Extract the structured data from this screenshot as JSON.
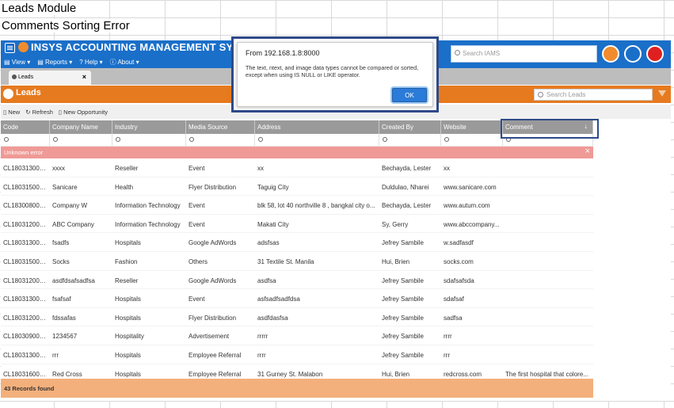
{
  "captions": {
    "line1": "Leads Module",
    "line2": "Comments Sorting Error"
  },
  "app": {
    "title": "INSYS ACCOUNTING MANAGEMENT SYSTEM",
    "menu": [
      "View",
      "Reports",
      "Help",
      "About"
    ],
    "search_placeholder": "Search IAMS",
    "colors": {
      "header": "#1a6fc9",
      "accent": "#e67a1f",
      "error": "#ef9a96",
      "footer": "#f3b07c"
    }
  },
  "tab": {
    "label": "Leads"
  },
  "leads": {
    "title": "Leads",
    "search_placeholder": "Search Leads",
    "toolbar": {
      "new": "New",
      "refresh": "Refresh",
      "new_opportunity": "New Opportunity"
    }
  },
  "grid": {
    "columns": [
      "Code",
      "Company Name",
      "Industry",
      "Media Source",
      "Address",
      "Created By",
      "Website",
      "Comment"
    ],
    "sort_indicator": "↓",
    "error_text": "Unknown error",
    "rows": [
      [
        "CL180313000...",
        "xxxx",
        "Reseller",
        "Event",
        "xx",
        "Bechayda, Lester",
        "xx",
        ""
      ],
      [
        "CL180315000...",
        "Sanicare",
        "Health",
        "Flyer Distribution",
        "Taguig City",
        "Duldulao, Nharei",
        "www.sanicare.com",
        ""
      ],
      [
        "CL183008000...",
        "Company W",
        "Information Technology",
        "Event",
        "blk 58, lot 40 northville 8 , bangkal city o...",
        "Bechayda, Lester",
        "www.autum.com",
        ""
      ],
      [
        "CL180312000...",
        "ABC Company",
        "Information Technology",
        "Event",
        "Makati City",
        "Sy, Gerry",
        "www.abccompany...",
        ""
      ],
      [
        "CL180313000...",
        "fsadfs",
        "Hospitals",
        "Google AdWords",
        "adsfsas",
        "Jefrey Sambile",
        "w.sadfasdf",
        ""
      ],
      [
        "CL180315000...",
        "Socks",
        "Fashion",
        "Others",
        "31 Textile St. Manila",
        "Hui, Brien",
        "socks.com",
        ""
      ],
      [
        "CL180312000...",
        "asdfdsafsadfsa",
        "Reseller",
        "Google AdWords",
        "asdfsa",
        "Jefrey Sambile",
        "sdafsafsda",
        ""
      ],
      [
        "CL180313000...",
        "fsafsaf",
        "Hospitals",
        "Event",
        "asfsadfsadfdsa",
        "Jefrey Sambile",
        "sdafsaf",
        ""
      ],
      [
        "CL180312000...",
        "fdssafas",
        "Hospitals",
        "Flyer Distribution",
        "asdfdasfsa",
        "Jefrey Sambile",
        "sadfsa",
        ""
      ],
      [
        "CL180309000...",
        "1234567",
        "Hospitality",
        "Advertisement",
        "rrrrr",
        "Jefrey Sambile",
        "rrrr",
        ""
      ],
      [
        "CL180313000...",
        "rrr",
        "Hospitals",
        "Employee Referral",
        "rrrr",
        "Jefrey Sambile",
        "rrr",
        ""
      ],
      [
        "CL180316000...",
        "Red Cross",
        "Hospitals",
        "Employee Referral",
        "31 Gurney St. Malabon",
        "Hui, Brien",
        "redcross.com",
        "The first hospital that colore..."
      ]
    ],
    "footer": "43 Records found"
  },
  "dialog": {
    "title": "From 192.168.1.8:8000",
    "message": "The text, ntext, and image data types cannot be compared or sorted, except when using IS NULL or LIKE operator.",
    "ok_label": "OK"
  }
}
